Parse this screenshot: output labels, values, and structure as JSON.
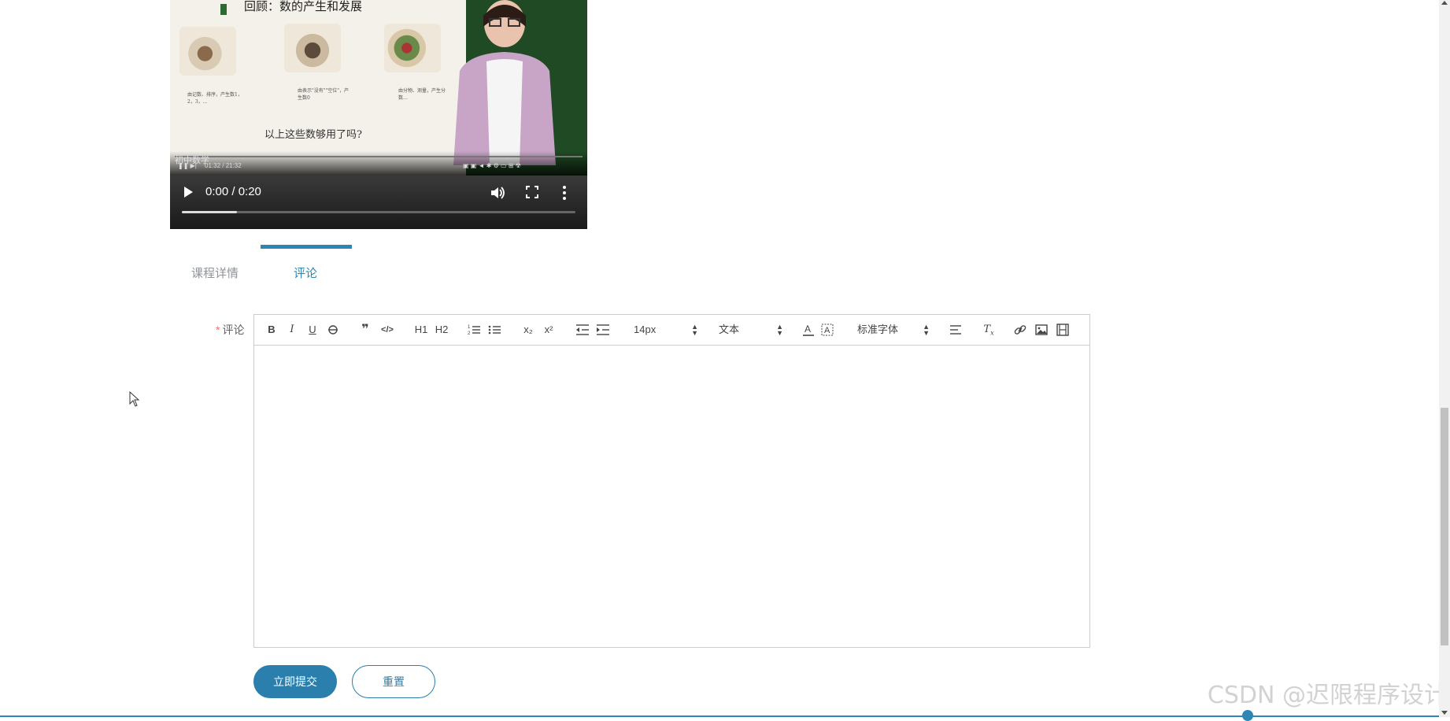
{
  "video": {
    "slide_title": "回顾：数的产生和发展",
    "slide_captions": [
      "由记数、排序，产生数1，2，3，…",
      "由表示\"没有\"\"空位\"，产生数0",
      "由分物、测量，产生分数…"
    ],
    "slide_question": "以上这些数够用了吗?",
    "inner_label": "初中数学",
    "inner_time": "01:32 / 21:32",
    "time_display": "0:00 / 0:20",
    "progress": 0.14
  },
  "tabs": [
    {
      "label": "课程详情",
      "active": false
    },
    {
      "label": "评论",
      "active": true
    }
  ],
  "form": {
    "required_mark": "*",
    "comment_label": "评论",
    "submit_label": "立即提交",
    "reset_label": "重置"
  },
  "toolbar": {
    "bold": "B",
    "italic": "I",
    "underline": "U",
    "h1": "H1",
    "h2": "H2",
    "sub": "x₂",
    "sup": "x²",
    "size_value": "14px",
    "header_value": "文本",
    "font_value": "标准字体"
  },
  "watermark": "CSDN @迟限程序设计",
  "colors": {
    "accent": "#2e86b4",
    "button": "#2a7fad",
    "required": "#f56c6c"
  }
}
